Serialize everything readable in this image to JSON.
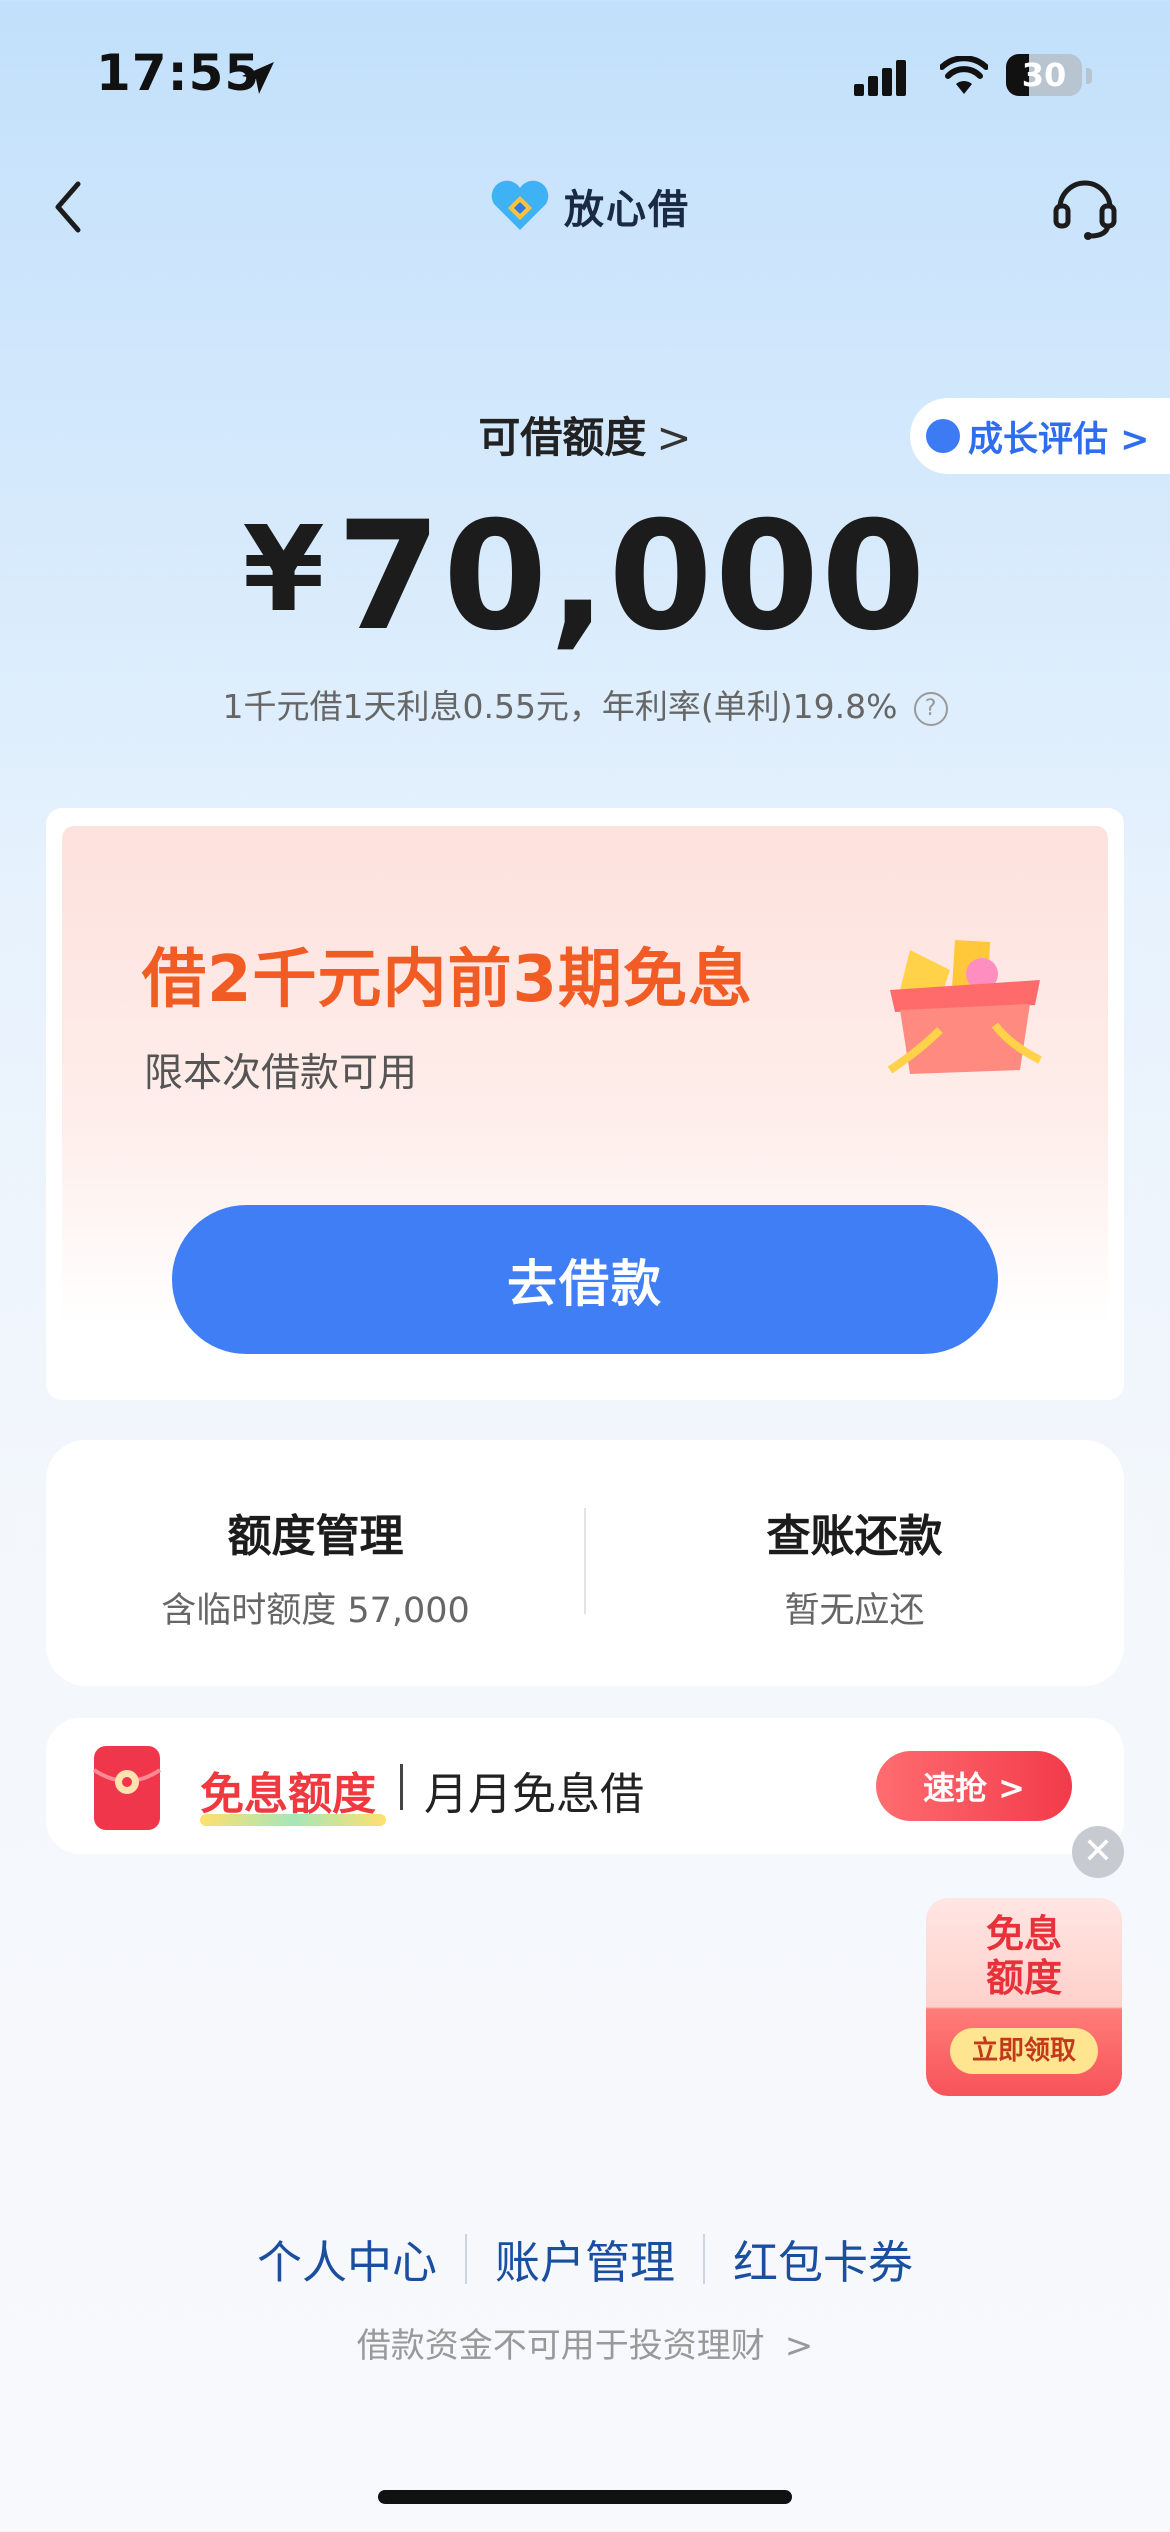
{
  "status_bar": {
    "time": "17:55",
    "battery": "30"
  },
  "nav": {
    "brand_name": "放心借"
  },
  "credit": {
    "label": "可借额度",
    "chevron": ">",
    "amount_symbol": "¥",
    "amount": "70,000",
    "rate_text": "1千元借1天利息0.55元，年利率(单利)19.8%",
    "help": "?",
    "growth_label": "成长评估 >"
  },
  "promo": {
    "title": "借2千元内前3期免息",
    "subtitle": "限本次借款可用",
    "button_label": "去借款"
  },
  "actions": [
    {
      "title": "额度管理",
      "subtitle": "含临时额度 57,000"
    },
    {
      "title": "查账还款",
      "subtitle": "暂无应还"
    }
  ],
  "banner": {
    "tag": "免息额度",
    "text": "月月免息借",
    "button_label": "速抢 >"
  },
  "float_widget": {
    "close": "✕",
    "title_line1": "免息",
    "title_line2": "额度",
    "button_label": "立即领取"
  },
  "footer": {
    "links": [
      "个人中心",
      "账户管理",
      "红包卡券"
    ],
    "notice": "借款资金不可用于投资理财",
    "notice_chevron": ">"
  },
  "colors": {
    "accent": "#3f7ef5",
    "promo_orange": "#f15c24",
    "red": "#f0383f",
    "link": "#1a4fa0"
  }
}
